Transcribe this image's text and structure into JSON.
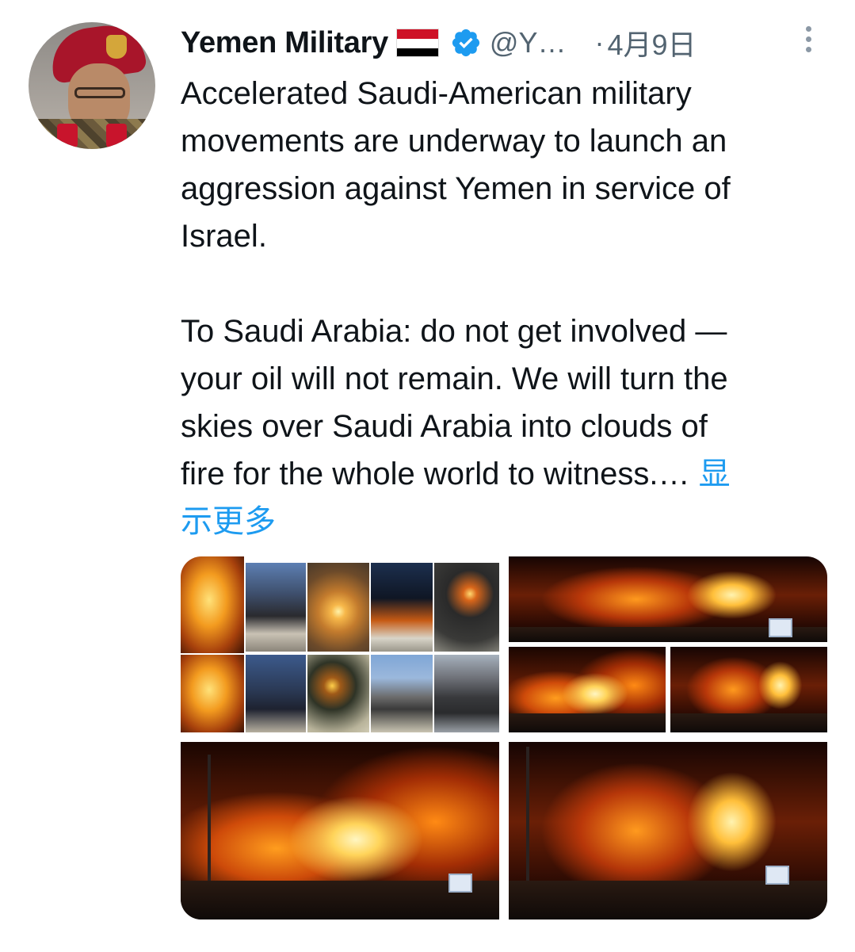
{
  "tweet": {
    "author_name": "Yemen Military",
    "author_flag": "Yemen flag",
    "handle": "@Y…",
    "separator": "·",
    "date": "4月9日",
    "text_lines": [
      "Accelerated Saudi-American military",
      "movements are underway to launch an",
      "aggression against Yemen in service of",
      "Israel.",
      "",
      "To Saudi Arabia: do not get involved —",
      "your oil will not remain. We will turn the",
      "skies over Saudi Arabia into clouds of",
      "fire for the whole world to witness.…"
    ],
    "show_more_part1": "显",
    "show_more_part2": "示更多",
    "icons": {
      "verified": "verified-badge-icon",
      "more": "more-options-icon"
    },
    "colors": {
      "link": "#1d9bf0",
      "secondary_text": "#536471",
      "primary_text": "#0f1419"
    },
    "media_count": 4
  }
}
